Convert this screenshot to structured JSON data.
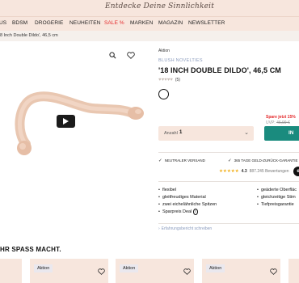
{
  "header": {
    "slogan": "Entdecke Deine Sinnlichkeit"
  },
  "nav": {
    "items": [
      {
        "label": "US",
        "sale": false
      },
      {
        "label": "BDSM",
        "sale": false
      },
      {
        "label": "DROGERIE",
        "sale": false
      },
      {
        "label": "NEUHEITEN",
        "sale": false
      },
      {
        "label": "SALE %",
        "sale": true
      },
      {
        "label": "MARKEN",
        "sale": false
      },
      {
        "label": "MAGAZIN",
        "sale": false
      },
      {
        "label": "NEWSLETTER",
        "sale": false
      }
    ]
  },
  "breadcrumb": {
    "current": "8 Inch Double Dildo', 46,5 cm"
  },
  "gallery": {
    "zoom_icon": "search-icon",
    "wishlist_icon": "heart-icon",
    "play_icon": "play-icon"
  },
  "product": {
    "aktion_label": "Aktion",
    "brand": "BLUSH NOVELTIES",
    "title": "'18 INCH DOUBLE DILDO', 46,5 CM",
    "rating_stars": "♥♥♥♥♥",
    "rating_count": "(5)",
    "rating_value": 0
  },
  "pricing": {
    "promo": "Spare jetzt 15%",
    "uvp_label": "UVP:",
    "uvp_price": "46,99 €"
  },
  "quantity": {
    "label": "Anzahl",
    "value": "1"
  },
  "cart": {
    "label": "IN"
  },
  "usps": {
    "shipping": "NEUTRALER VERSAND",
    "returns": "365 TAGE GELD-ZURÜCK-GARANTIE",
    "check_icon": "check-icon"
  },
  "trust": {
    "stars": "★★★★★",
    "score": "4.3",
    "reviews": "887.245 Bewertungen",
    "badge": "e"
  },
  "features": {
    "left": [
      "flexibel",
      "gleitfreudiges Material",
      "zwei eichelähnliche Spitzen",
      "Sparpreis Deal"
    ],
    "right": [
      "geäderte Oberfläc",
      "gleichzeitige Stim",
      "Tiefpreisgarantie"
    ],
    "info_icon": "info-icon"
  },
  "review_link": "Erfahrungsbericht schreiben",
  "recommendations": {
    "title": "HR SPASS MACHT.",
    "cards": [
      {
        "tag": "Aktion"
      },
      {
        "tag": "Aktion"
      },
      {
        "tag": "Aktion"
      },
      {
        "tag": "Aktion"
      }
    ]
  },
  "colors": {
    "accent_bg": "#f7e6dd",
    "cart_button": "#1a8b7e",
    "sale": "#e4292b",
    "brand_link": "#8a9bbd"
  }
}
